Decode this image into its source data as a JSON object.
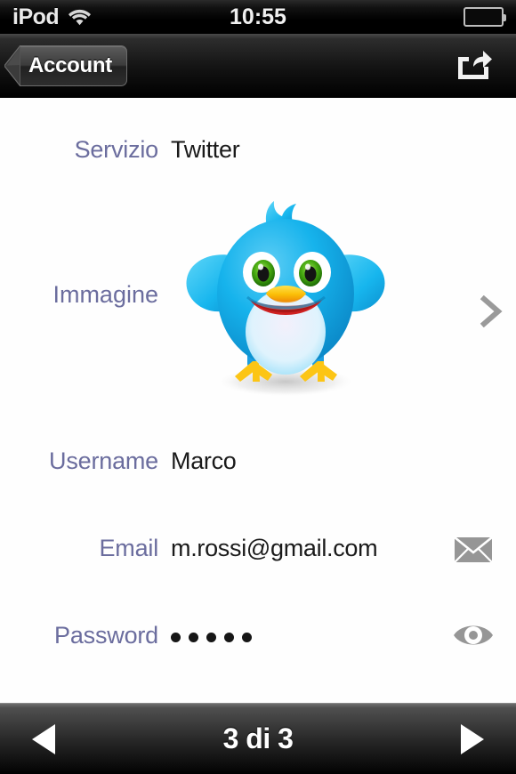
{
  "status_bar": {
    "carrier": "iPod",
    "wifi_icon": "wifi-icon",
    "time": "10:55",
    "battery_icon": "battery-icon"
  },
  "nav_bar": {
    "back_label": "Account",
    "share_icon": "share-icon"
  },
  "form": {
    "rows": [
      {
        "label": "Servizio",
        "value": "Twitter"
      },
      {
        "label": "Immagine",
        "value": ""
      },
      {
        "label": "Username",
        "value": "Marco"
      },
      {
        "label": "Email",
        "value": "m.rossi@gmail.com"
      },
      {
        "label": "Password",
        "value": "•••••"
      }
    ],
    "password_dot_count": 5,
    "image_accessory_icon": "chevron-right-icon",
    "email_accessory_icon": "envelope-icon",
    "password_accessory_icon": "eye-icon",
    "avatar_alt": "twitter-bird-avatar"
  },
  "toolbar": {
    "prev_icon": "triangle-left-icon",
    "page_indicator": "3 di 3",
    "next_icon": "triangle-right-icon"
  },
  "colors": {
    "label": "#6b6d9e",
    "value": "#1a1a1a",
    "accessory_gray": "#969696",
    "bird_blue": "#1fb6ed",
    "bird_beak": "#ffc20e"
  }
}
